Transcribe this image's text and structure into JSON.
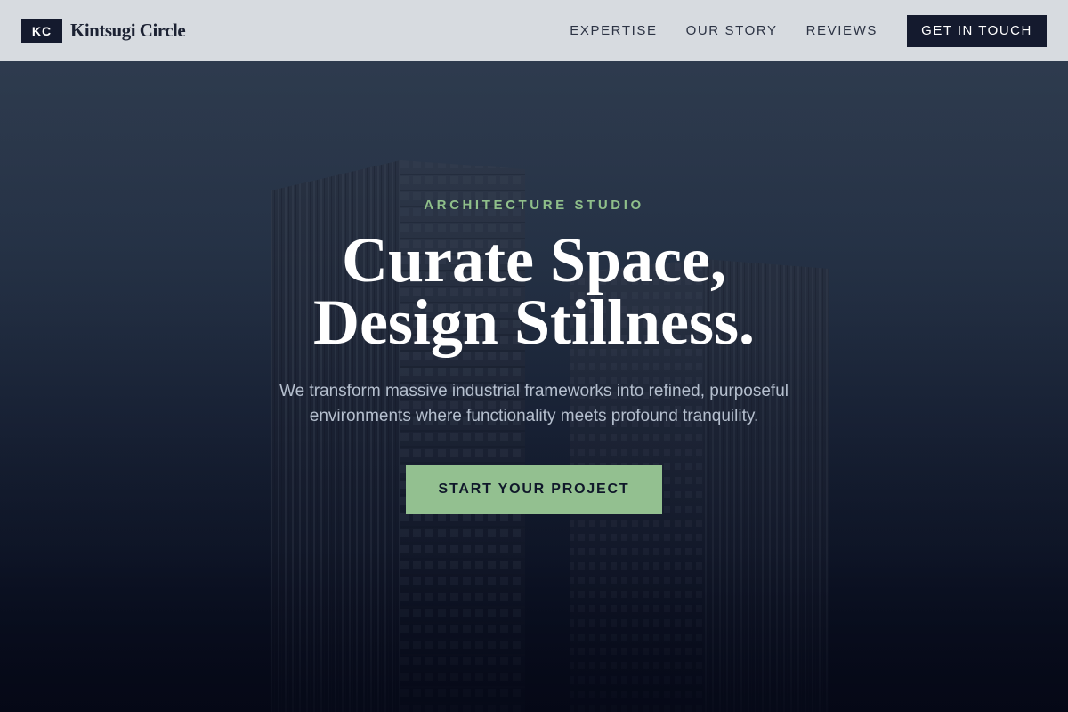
{
  "nav": {
    "brand_mark": "KC",
    "brand_name": "Kintsugi Circle",
    "links": [
      {
        "label": "EXPERTISE"
      },
      {
        "label": "OUR STORY"
      },
      {
        "label": "REVIEWS"
      }
    ],
    "cta_label": "GET IN TOUCH"
  },
  "hero": {
    "eyebrow": "ARCHITECTURE STUDIO",
    "headline_line1": "Curate Space,",
    "headline_line2": "Design Stillness.",
    "subtext_line1": "We transform massive industrial frameworks into refined, purposeful",
    "subtext_line2": "environments where functionality meets profound tranquility.",
    "cta_label": "START YOUR PROJECT"
  },
  "colors": {
    "nav_background": "#d7dbe0",
    "dark_navy": "#141a2e",
    "accent_green": "#93c090",
    "eyebrow_green": "#8fbf8a",
    "hero_top": "#2e3b4e",
    "hero_bottom": "#060a19"
  }
}
